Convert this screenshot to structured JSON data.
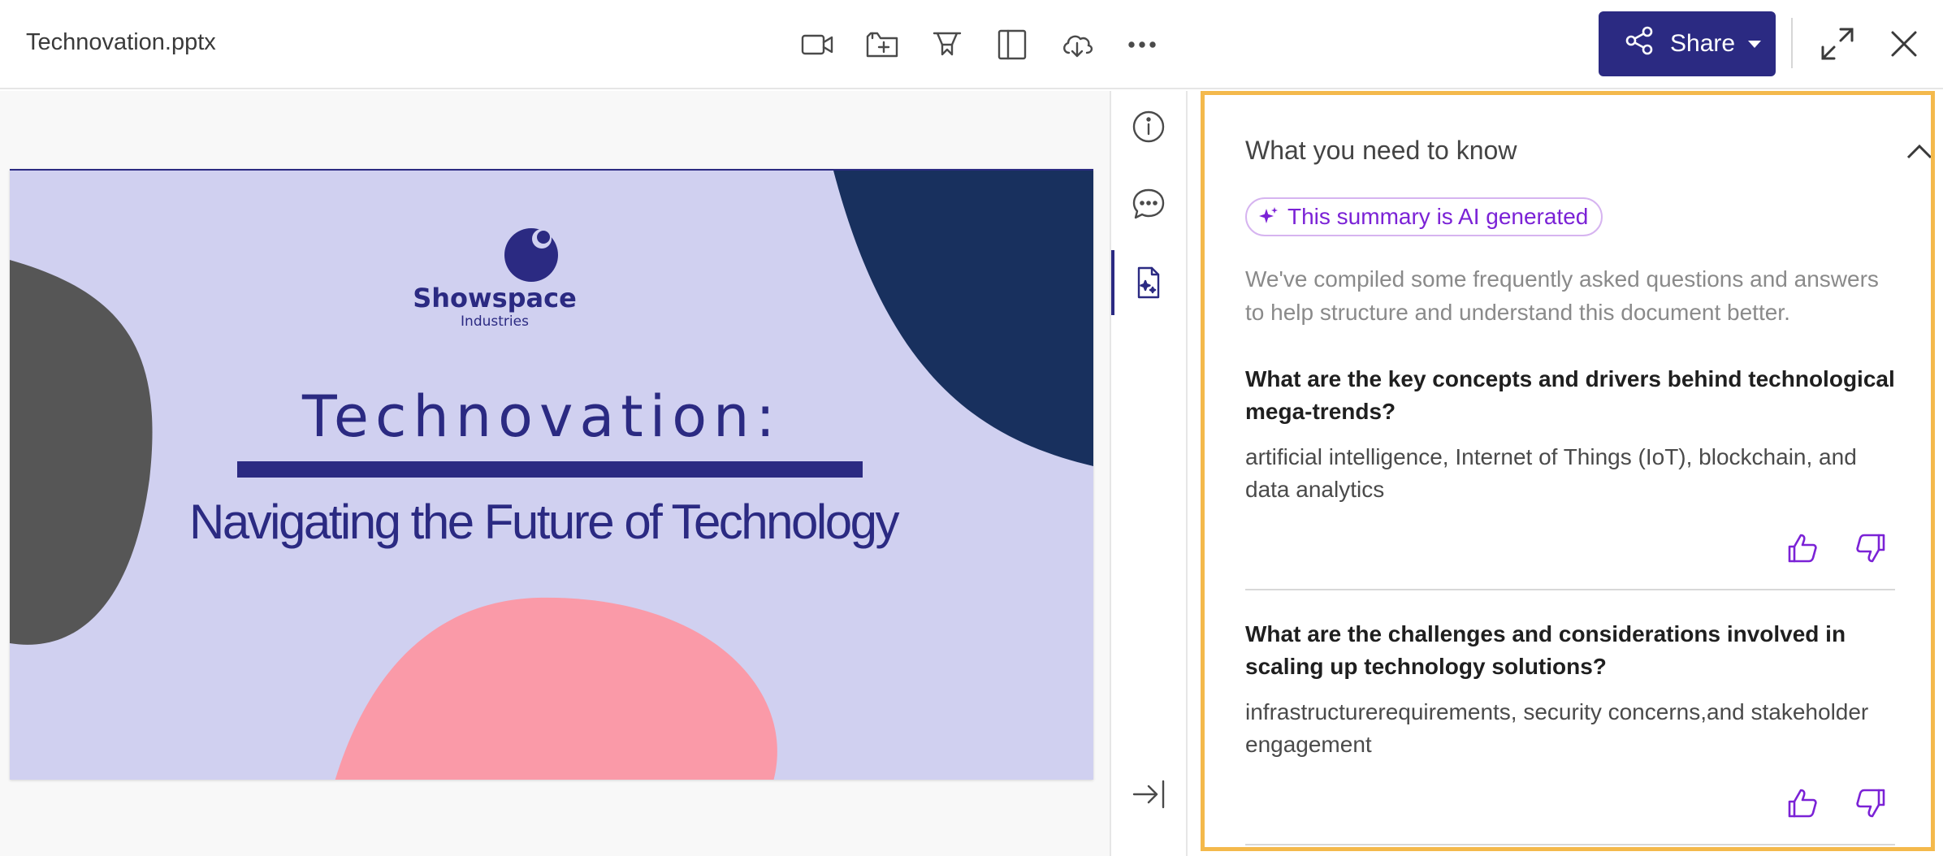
{
  "app": {
    "file_title": "Technovation.pptx",
    "share_label": "Share",
    "accent_color": "#2b2a82",
    "ai_color": "#7b22d6",
    "highlight_color": "#f4b94c"
  },
  "toolbar": {
    "icons": [
      "video-icon",
      "add-to-folder-icon",
      "pin-icon",
      "layout-panel-icon",
      "cloud-download-icon",
      "more-options-icon"
    ]
  },
  "slide": {
    "brand_name": "Showspace",
    "brand_sub": "Industries",
    "title": "Technovation:",
    "subtitle": "Navigating the Future of Technology"
  },
  "summary": {
    "heading": "What you need to know",
    "ai_badge": "This summary is AI generated",
    "intro": "We've compiled some frequently asked questions and answers to help structure and understand this document better.",
    "items": [
      {
        "question": "What are the key concepts and drivers behind technological mega-trends?",
        "answer": "artificial intelligence, Internet of Things (IoT), blockchain, and data analytics"
      },
      {
        "question": "What are the challenges and considerations involved in scaling up technology solutions?",
        "answer": "infrastructurerequirements, security concerns,and stakeholder engagement"
      }
    ]
  }
}
